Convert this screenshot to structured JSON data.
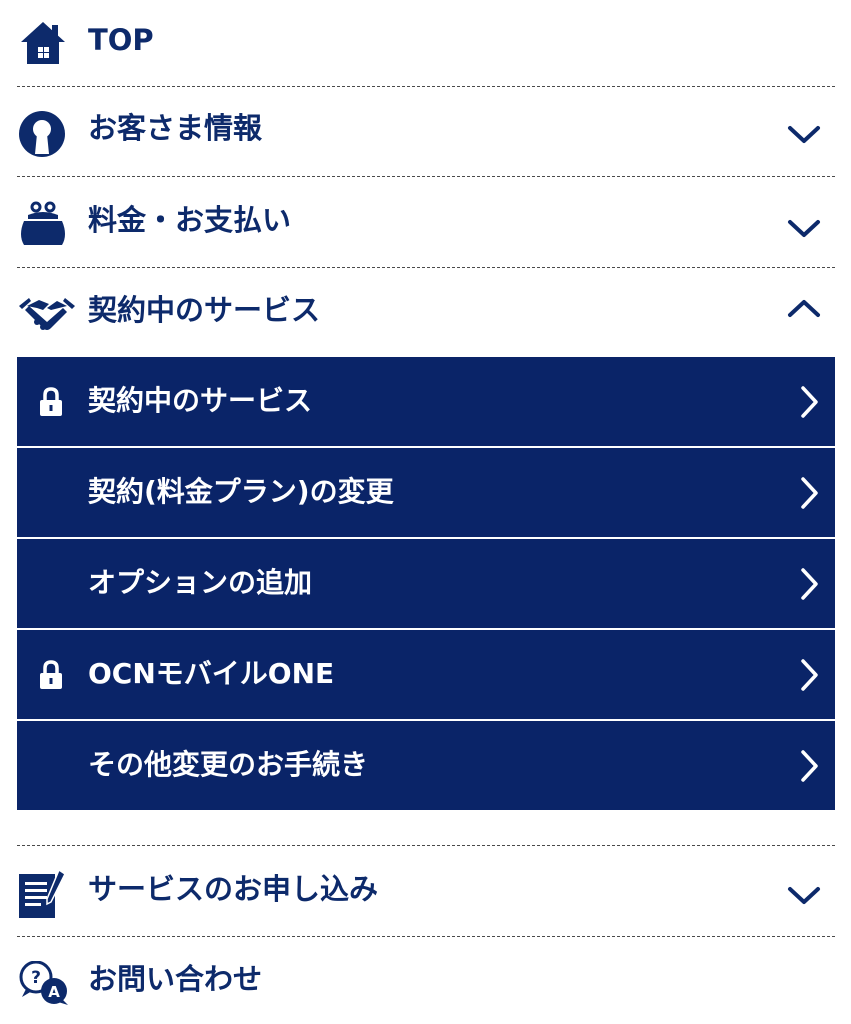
{
  "menu": {
    "top": {
      "label": "TOP",
      "icon": "home-icon"
    },
    "customer": {
      "label": "お客さま情報",
      "icon": "keyhole-icon",
      "chevron": "chevron-down-icon"
    },
    "billing": {
      "label": "料金・お支払い",
      "icon": "purse-icon",
      "chevron": "chevron-down-icon"
    },
    "services": {
      "label": "契約中のサービス",
      "icon": "handshake-icon",
      "chevron": "chevron-up-icon",
      "items": [
        {
          "label": "契約中のサービス",
          "locked": true
        },
        {
          "label": "契約(料金プラン)の変更",
          "locked": false
        },
        {
          "label": "オプションの追加",
          "locked": false
        },
        {
          "label": "OCNモバイルONE",
          "locked": true
        },
        {
          "label": "その他変更のお手続き",
          "locked": false
        }
      ]
    },
    "apply": {
      "label": "サービスのお申し込み",
      "icon": "document-pen-icon",
      "chevron": "chevron-down-icon"
    },
    "contact": {
      "label": "お問い合わせ",
      "icon": "question-answer-icon"
    }
  },
  "colors": {
    "navy": "#0a2468",
    "text": "#0d2a6b",
    "white": "#ffffff"
  }
}
